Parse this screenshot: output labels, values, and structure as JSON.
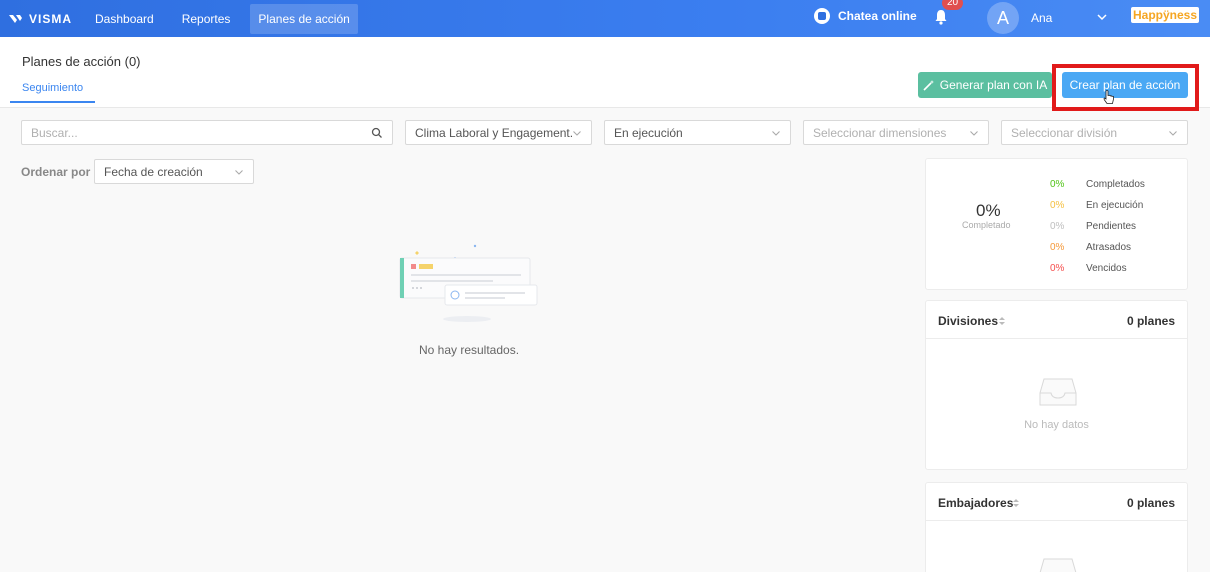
{
  "topbar": {
    "logo": "VISMA",
    "nav": [
      "Dashboard",
      "Reportes",
      "Planes de acción"
    ],
    "chat_label": "Chatea online",
    "notification_count": "20",
    "avatar_initial": "A",
    "username": "Ana",
    "brand": "Happÿness"
  },
  "header": {
    "title": "Planes de acción (0)",
    "tab": "Seguimiento",
    "btn_ia": "Generar plan con IA",
    "btn_crear": "Crear plan de acción"
  },
  "filters": {
    "search_placeholder": "Buscar...",
    "survey": "Clima Laboral y Engagement...",
    "status": "En ejecución",
    "dimensions_placeholder": "Seleccionar dimensiones",
    "division_placeholder": "Seleccionar división"
  },
  "sort": {
    "label": "Ordenar por",
    "value": "Fecha de creación"
  },
  "empty": {
    "text": "No hay resultados."
  },
  "stats": {
    "total_pct": "0%",
    "total_label": "Completado",
    "rows": [
      {
        "pct": "0%",
        "label": "Completados",
        "color": "#52c41a"
      },
      {
        "pct": "0%",
        "label": "En ejecución",
        "color": "#f5c042"
      },
      {
        "pct": "0%",
        "label": "Pendientes",
        "color": "#bfbfbf"
      },
      {
        "pct": "0%",
        "label": "Atrasados",
        "color": "#f59a3b"
      },
      {
        "pct": "0%",
        "label": "Vencidos",
        "color": "#f5504f"
      }
    ]
  },
  "divisiones": {
    "title": "Divisiones",
    "count": "0 planes",
    "empty": "No hay datos"
  },
  "embajadores": {
    "title": "Embajadores",
    "count": "0 planes"
  },
  "colors": {
    "topbar": "#3b7ef0",
    "primary": "#4aa8f4",
    "ia_button": "#5bbfa0",
    "highlight": "#e11a1a"
  }
}
